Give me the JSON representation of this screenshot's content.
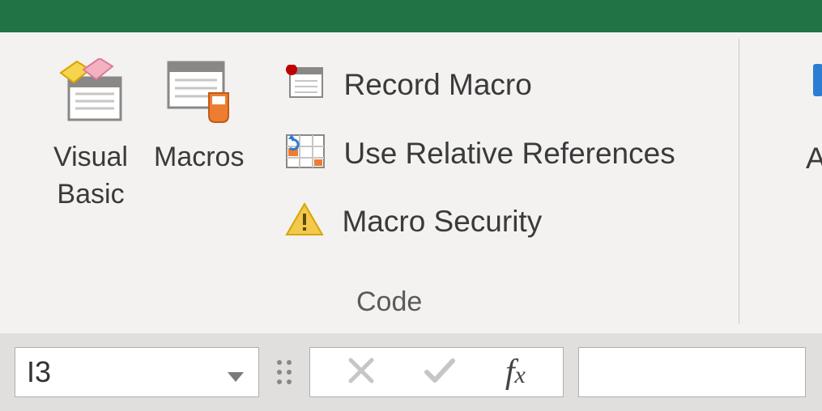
{
  "buttons": {
    "visual_basic": "Visual\nBasic",
    "macros": "Macros",
    "record_macro": "Record Macro",
    "use_relative": "Use Relative References",
    "macro_security": "Macro Security"
  },
  "group": {
    "code": "Code"
  },
  "truncated": "A",
  "name_box": {
    "value": "I3"
  }
}
